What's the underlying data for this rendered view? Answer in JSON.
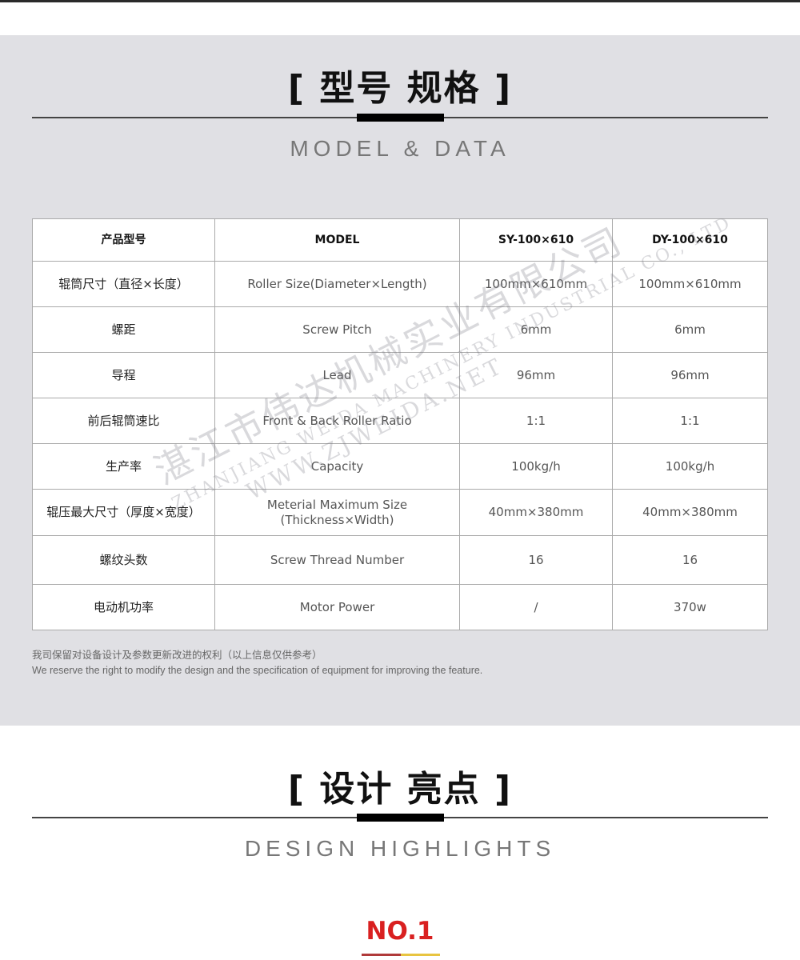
{
  "section1": {
    "title": "[ 型号  规格 ]",
    "subtitle": "MODEL & DATA"
  },
  "table": {
    "headers": [
      "产品型号",
      "MODEL",
      "SY-100×610",
      "DY-100×610"
    ],
    "rows": [
      [
        "辊筒尺寸（直径×长度）",
        "Roller Size(Diameter×Length)",
        "100mm×610mm",
        "100mm×610mm"
      ],
      [
        "螺距",
        "Screw Pitch",
        "6mm",
        "6mm"
      ],
      [
        "导程",
        "Lead",
        "96mm",
        "96mm"
      ],
      [
        "前后辊筒速比",
        "Front & Back Roller Ratio",
        "1:1",
        "1:1"
      ],
      [
        "生产率",
        "Capacity",
        "100kg/h",
        "100kg/h"
      ],
      [
        "辊压最大尺寸（厚度×宽度）",
        "Meterial Maximum Size\n(Thickness×Width)",
        "40mm×380mm",
        "40mm×380mm"
      ],
      [
        "螺纹头数",
        "Screw Thread Number",
        "16",
        "16"
      ],
      [
        "电动机功率",
        "Motor Power",
        "/",
        "370w"
      ]
    ]
  },
  "watermark": {
    "cn": "湛江市伟达机械实业有限公司",
    "en": "ZHANJIANG WEIDA MACHINERY INDUSTRIAL CO., LTD",
    "url": "WWW.ZJWEIDA.NET"
  },
  "note": {
    "cn": "我司保留对设备设计及参数更新改进的权利（以上信息仅供参考）",
    "en": "We reserve the right to modify the design and the specification of equipment for improving the feature."
  },
  "section2": {
    "title": "[ 设计  亮点 ]",
    "subtitle": "DESIGN HIGHLIGHTS"
  },
  "highlight": {
    "label": "NO.1",
    "color": "#d92020"
  }
}
